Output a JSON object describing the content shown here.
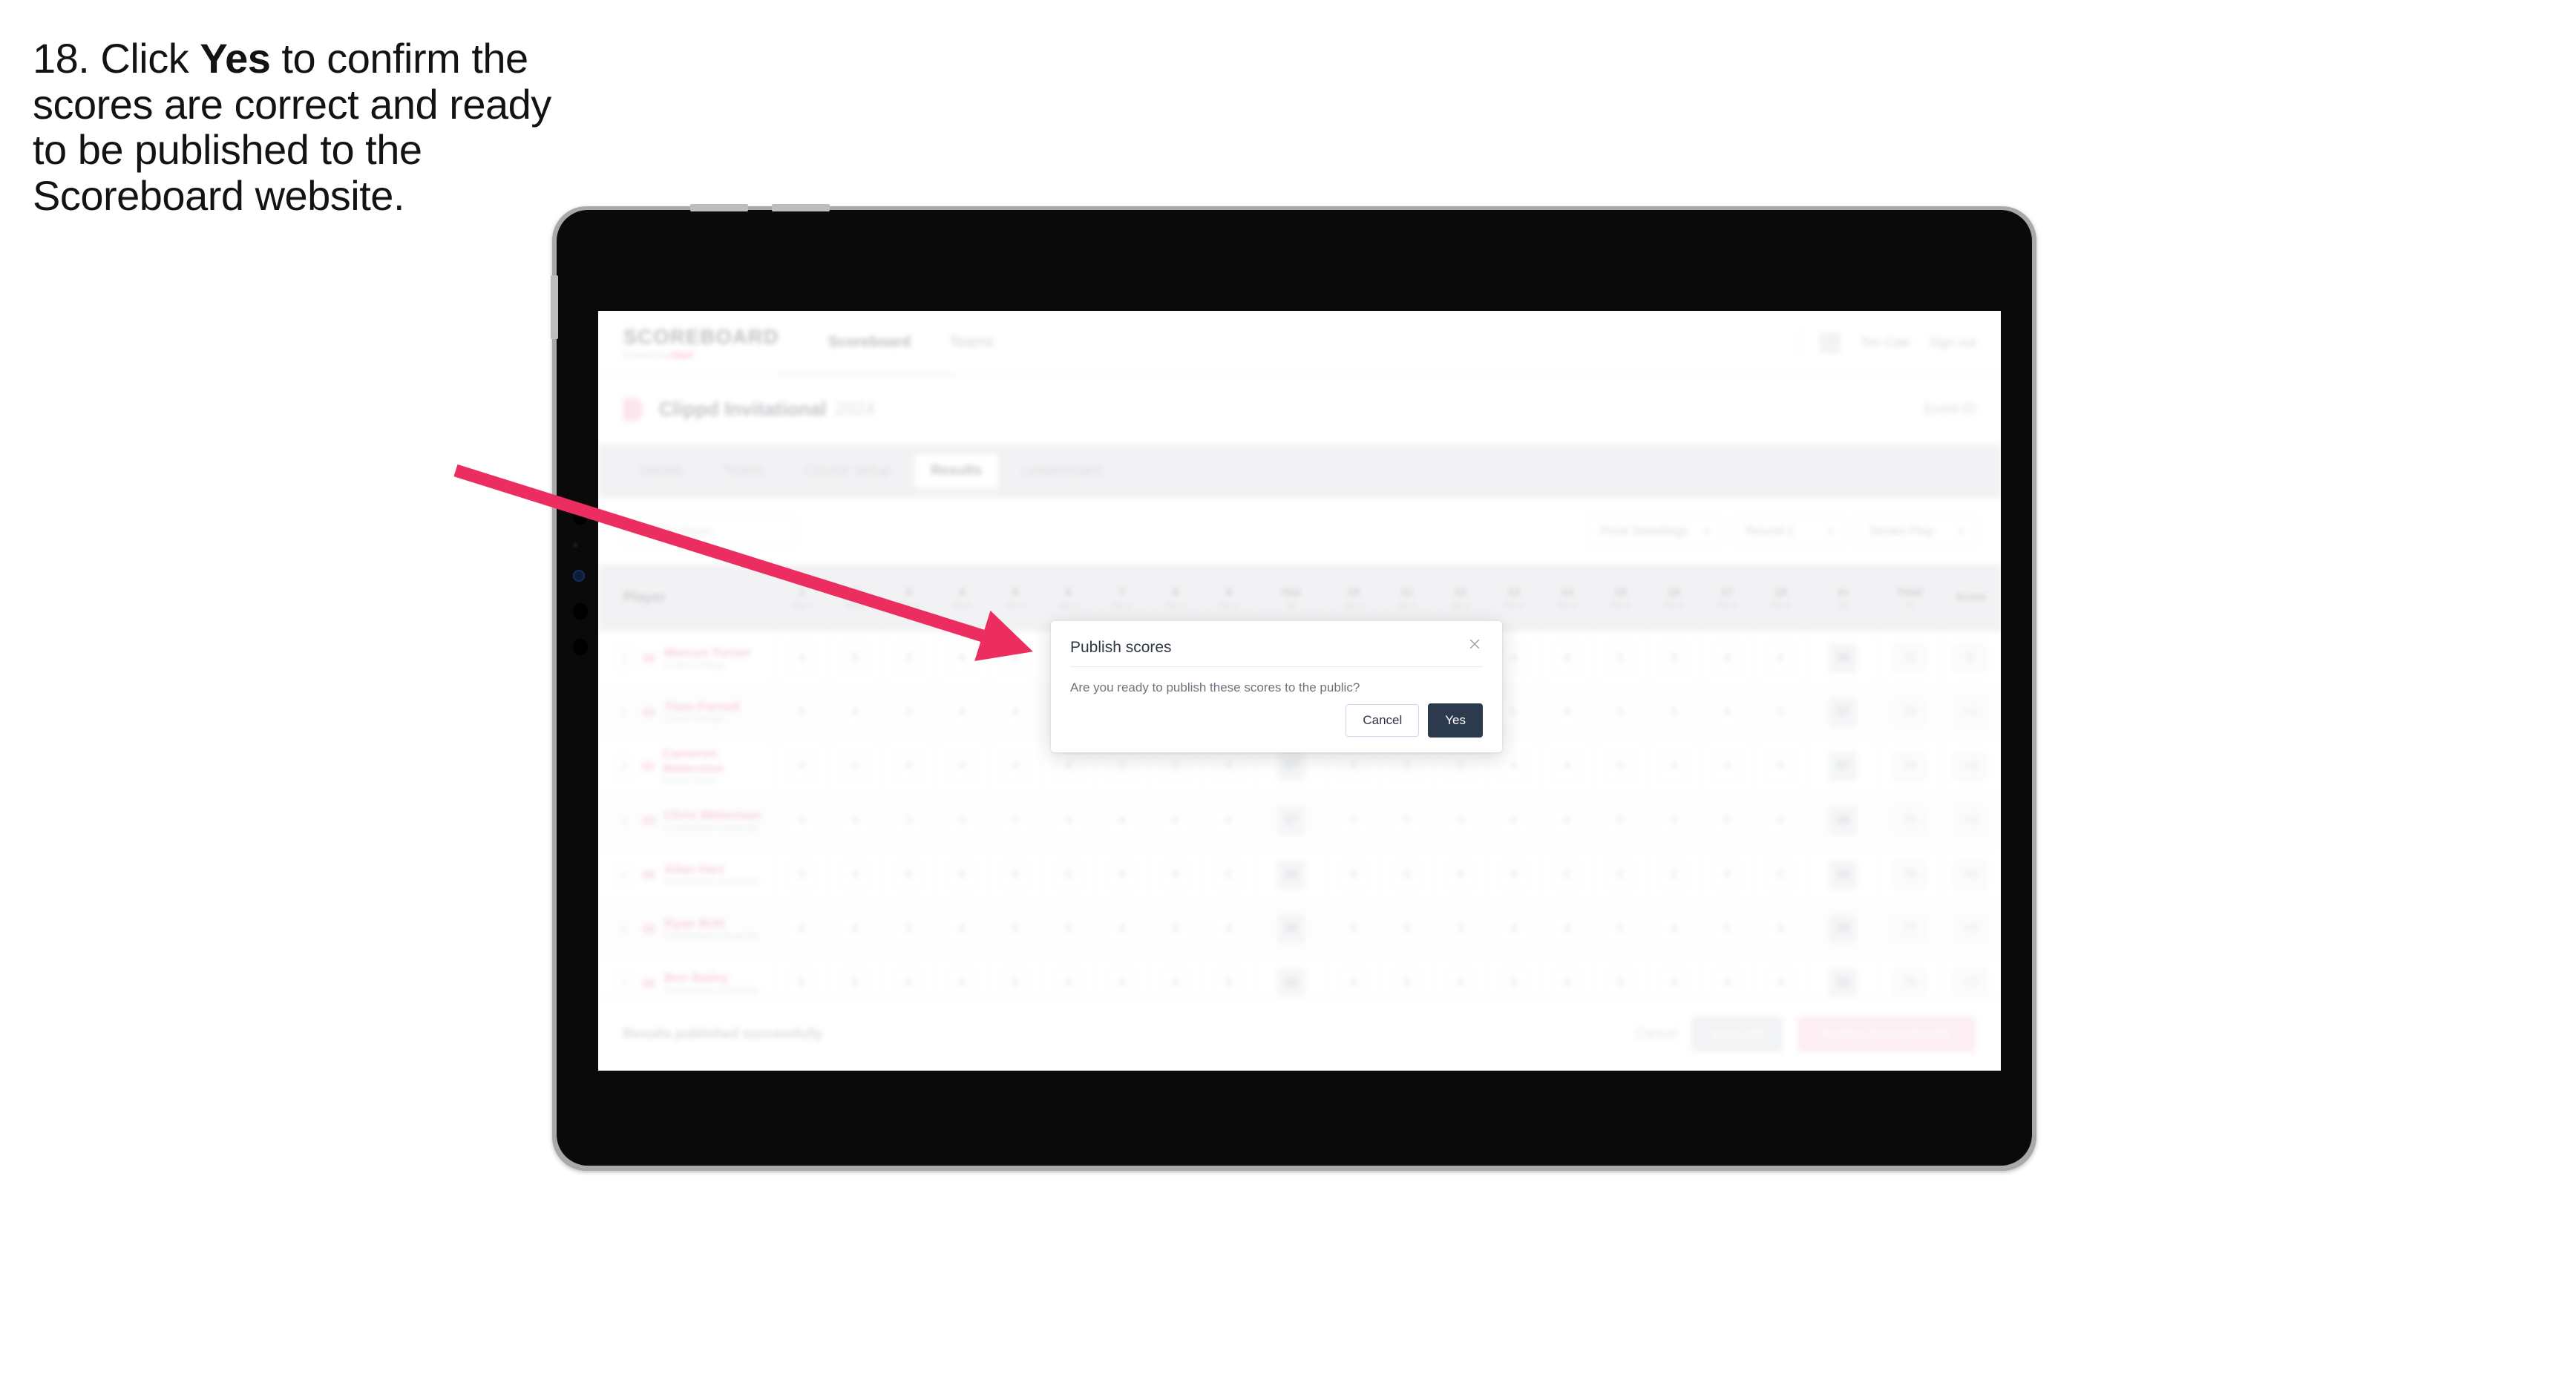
{
  "instruction": {
    "step_number": "18.",
    "text_before": " Click ",
    "emphasis": "Yes",
    "text_after": " to confirm the scores are correct and ready to be published to the Scoreboard website."
  },
  "device": {
    "type": "tablet"
  },
  "app": {
    "logo": "SCOREBOARD",
    "logo_sub_prefix": "Powered by ",
    "logo_sub_brand": "clippd",
    "nav": [
      {
        "label": "Scoreboard",
        "active": true
      },
      {
        "label": "Teams",
        "active": false
      }
    ],
    "header_right": {
      "user": "Tim Cole",
      "signout": "Sign out"
    },
    "event": {
      "title": "Clippd Invitational",
      "subtitle": "2024",
      "right_link": "Event ID"
    },
    "tabs": [
      {
        "label": "Details",
        "active": false
      },
      {
        "label": "Teams",
        "active": false
      },
      {
        "label": "Course Setup",
        "active": false
      },
      {
        "label": "Results",
        "active": true
      },
      {
        "label": "Leaderboard",
        "active": false
      }
    ],
    "filters": {
      "search_placeholder": "Search player",
      "select_round": "Final Standings",
      "select_sort": "Round 1",
      "select_view": "Stroke Play"
    },
    "table": {
      "player_header": "Player",
      "hole_headers": [
        {
          "num": "1",
          "par": "Par 4"
        },
        {
          "num": "2",
          "par": "Par 4"
        },
        {
          "num": "3",
          "par": "Par 3"
        },
        {
          "num": "4",
          "par": "Par 5"
        },
        {
          "num": "5",
          "par": "Par 4"
        },
        {
          "num": "6",
          "par": "Par 4"
        },
        {
          "num": "7",
          "par": "Par 3"
        },
        {
          "num": "8",
          "par": "Par 4"
        },
        {
          "num": "9",
          "par": "Par 4"
        },
        {
          "num": "Out",
          "par": "36"
        },
        {
          "num": "10",
          "par": "Par 4"
        },
        {
          "num": "11",
          "par": "Par 5"
        },
        {
          "num": "12",
          "par": "Par 3"
        },
        {
          "num": "13",
          "par": "Par 4"
        },
        {
          "num": "14",
          "par": "Par 4"
        },
        {
          "num": "15",
          "par": "Par 5"
        },
        {
          "num": "16",
          "par": "Par 3"
        },
        {
          "num": "17",
          "par": "Par 4"
        },
        {
          "num": "18",
          "par": "Par 4"
        },
        {
          "num": "In",
          "par": "36"
        }
      ],
      "total_headers": [
        {
          "num": "Total",
          "par": "72"
        },
        {
          "num": "Score",
          "par": ""
        }
      ],
      "rows": [
        {
          "pos": "1",
          "name": "Marcus Turner",
          "club": "Coast College",
          "scores": [
            "4",
            "5",
            "3",
            "4",
            "5",
            "4",
            "3",
            "4",
            "4",
            "36",
            "4",
            "5",
            "3",
            "4",
            "4",
            "5",
            "3",
            "4",
            "4",
            "36"
          ],
          "total": "72",
          "score": "E"
        },
        {
          "pos": "2",
          "name": "Theo Parnell",
          "club": "Coast College",
          "scores": [
            "5",
            "4",
            "3",
            "4",
            "4",
            "5",
            "3",
            "4",
            "4",
            "36",
            "4",
            "4",
            "3",
            "5",
            "4",
            "5",
            "3",
            "4",
            "5",
            "37"
          ],
          "total": "73",
          "score": "+1"
        },
        {
          "pos": "3",
          "name": "Cameron Waterston",
          "club": "Sutton Hurst",
          "scores": [
            "4",
            "5",
            "4",
            "4",
            "4",
            "4",
            "3",
            "5",
            "4",
            "37",
            "4",
            "5",
            "3",
            "4",
            "4",
            "5",
            "4",
            "4",
            "4",
            "37"
          ],
          "total": "74",
          "score": "+2"
        },
        {
          "pos": "4",
          "name": "Chris Waterman",
          "club": "Sunderland University",
          "scores": [
            "4",
            "4",
            "3",
            "5",
            "5",
            "4",
            "4",
            "4",
            "4",
            "37",
            "5",
            "5",
            "3",
            "4",
            "4",
            "5",
            "3",
            "5",
            "4",
            "38"
          ],
          "total": "75",
          "score": "+3"
        },
        {
          "pos": "5",
          "name": "Allan Hart",
          "club": "Sunderland University",
          "scores": [
            "5",
            "4",
            "4",
            "4",
            "4",
            "5",
            "4",
            "4",
            "5",
            "39",
            "4",
            "5",
            "4",
            "4",
            "5",
            "5",
            "3",
            "4",
            "5",
            "39"
          ],
          "total": "78",
          "score": "+6"
        },
        {
          "pos": "6",
          "name": "Ryan Britt",
          "club": "Sunderland University",
          "scores": [
            "4",
            "4",
            "3",
            "4",
            "5",
            "5",
            "4",
            "5",
            "4",
            "38",
            "5",
            "5",
            "3",
            "4",
            "4",
            "5",
            "4",
            "5",
            "4",
            "39"
          ],
          "total": "77",
          "score": "+5"
        },
        {
          "pos": "7",
          "name": "Ben Bailey",
          "club": "Sunderland University",
          "scores": [
            "5",
            "5",
            "4",
            "4",
            "5",
            "4",
            "4",
            "4",
            "5",
            "40",
            "4",
            "5",
            "4",
            "5",
            "4",
            "5",
            "4",
            "4",
            "4",
            "39"
          ],
          "total": "79",
          "score": "+7"
        }
      ]
    },
    "footer": {
      "note": "Results published successfully",
      "cancel_link": "Cancel",
      "save_button": "Save edit",
      "publish_button": "Publish Round Results"
    }
  },
  "dialog": {
    "title": "Publish scores",
    "body": "Are you ready to publish these scores to the public?",
    "cancel_label": "Cancel",
    "confirm_label": "Yes",
    "close_icon": "close-icon"
  },
  "annotation": {
    "arrow_color": "#ec2d60"
  }
}
